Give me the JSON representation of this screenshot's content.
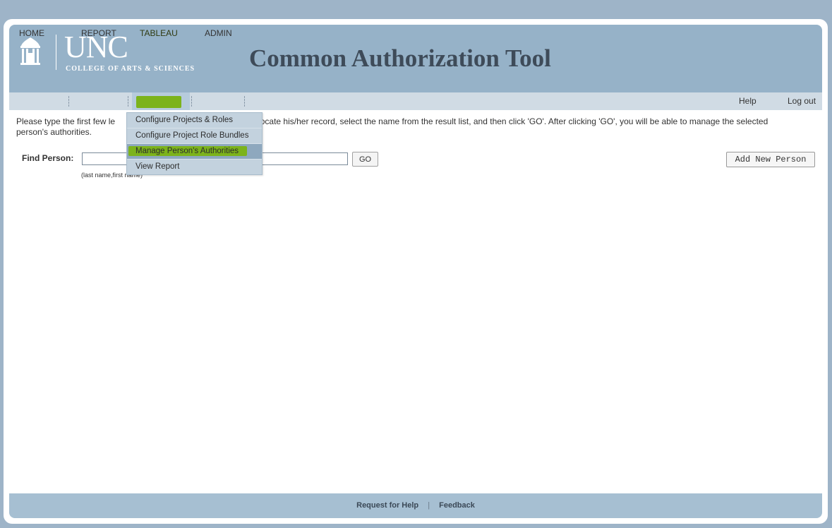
{
  "header": {
    "logo_main": "UNC",
    "logo_sub": "COLLEGE OF ARTS & SCIENCES",
    "title": "Common Authorization Tool"
  },
  "nav": {
    "home": "HOME",
    "report": "REPORT",
    "tableau": "TABLEAU",
    "admin": "ADMIN",
    "help": "Help",
    "logout": "Log out"
  },
  "dropdown": {
    "items": [
      "Configure Projects & Roles",
      "Configure Project Role Bundles",
      "Manage Person's Authorities",
      "View Report"
    ],
    "selected_index": 2
  },
  "main": {
    "instructions_before": "Please type the first few le",
    "instructions_after": "locate his/her record, select the name from the result list, and then click 'GO'. After clicking 'GO', you will be able to manage the selected",
    "instructions_line2": "person's authorities.",
    "find_label": "Find Person:",
    "find_value": "",
    "go_label": "GO",
    "hint": "(last name,first name)",
    "add_label": "Add New Person"
  },
  "footer": {
    "request": "Request for Help",
    "separator": "|",
    "feedback": "Feedback"
  },
  "colors": {
    "header_bg": "#96b2c8",
    "highlight": "#7cb31b"
  }
}
